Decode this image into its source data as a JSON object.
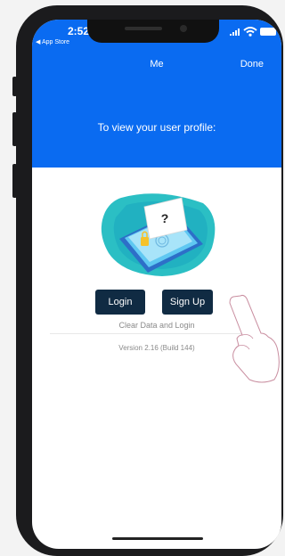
{
  "status_bar": {
    "time": "2:52",
    "back_app": "◀ App Store"
  },
  "nav": {
    "title": "Me",
    "done_label": "Done"
  },
  "header": {
    "prompt": "To view your user profile:"
  },
  "actions": {
    "login_label": "Login",
    "signup_label": "Sign Up",
    "clear_label": "Clear Data and Login"
  },
  "footer": {
    "version": "Version 2.16 (Build 144)"
  },
  "illustration": {
    "symbol": "?"
  },
  "colors": {
    "header_bg": "#0a6bf1",
    "button_bg": "#102b43",
    "muted_text": "#8a8a8a"
  }
}
